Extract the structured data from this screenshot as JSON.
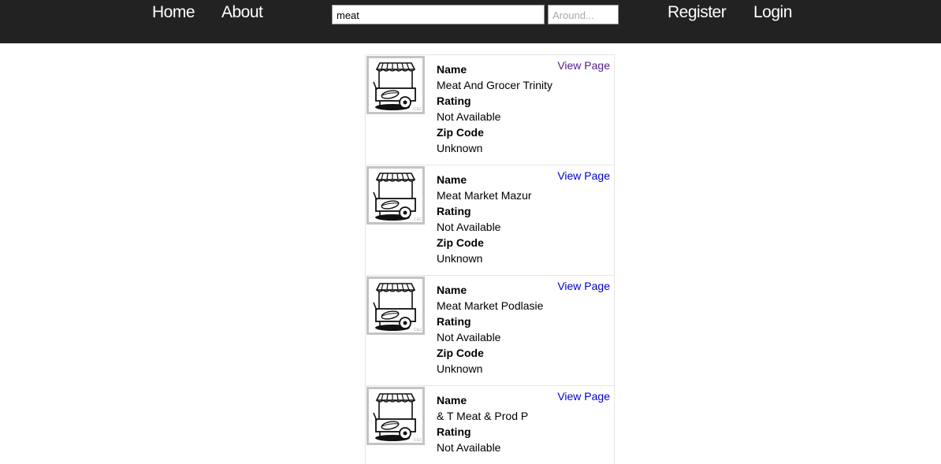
{
  "nav": {
    "home": "Home",
    "about": "About",
    "register": "Register",
    "login": "Login"
  },
  "search": {
    "query_value": "meat",
    "location_value": "",
    "location_placeholder": "Around..."
  },
  "labels": {
    "name": "Name",
    "rating": "Rating",
    "zip": "Zip Code",
    "view_page": "View Page"
  },
  "results": [
    {
      "name": "Meat And Grocer Trinity",
      "rating": "Not Available",
      "zip": "Unknown",
      "visited": true
    },
    {
      "name": "Meat Market Mazur",
      "rating": "Not Available",
      "zip": "Unknown",
      "visited": false
    },
    {
      "name": "Meat Market Podlasie",
      "rating": "Not Available",
      "zip": "Unknown",
      "visited": false
    },
    {
      "name": "& T Meat & Prod P",
      "rating": "Not Available",
      "zip": "",
      "visited": false
    }
  ],
  "colors": {
    "topbar": "#222222",
    "link": "#0000cc",
    "visited_link": "#551a8b"
  },
  "icons": {
    "thumbnail": "food-cart-icon"
  }
}
